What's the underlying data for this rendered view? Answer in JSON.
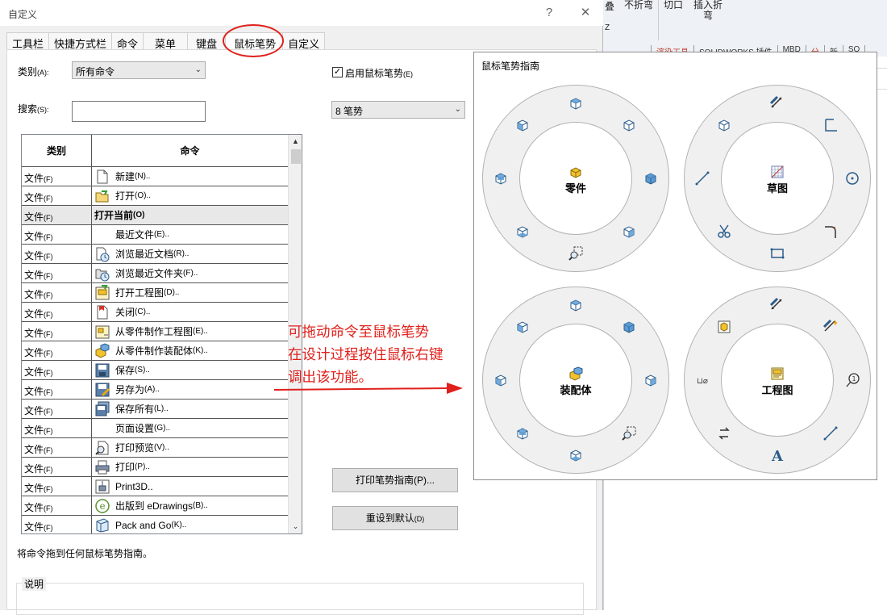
{
  "background_app": {
    "buttons": [
      {
        "label": "不折弯",
        "x": "770",
        "icon": "unfold-icon"
      },
      {
        "label": "切口",
        "icon": "rip-icon"
      },
      {
        "label": "插入折\n弯",
        "icon": "insert-bends-icon"
      }
    ],
    "left_fragments": [
      "叠",
      "Z"
    ],
    "tabs": [
      "",
      "渲染工具",
      "SOLIDWORKS 插件",
      "MBD",
      "分",
      "新",
      "SO"
    ],
    "accent": "#c0392b"
  },
  "dialog": {
    "title": "自定义",
    "help_glyph": "?",
    "close_glyph": "✕",
    "tabs": [
      "工具栏",
      "快捷方式栏",
      "命令",
      "菜单",
      "键盘",
      "鼠标笔势",
      "自定义"
    ],
    "active_tab": "鼠标笔势",
    "category_label": "类别",
    "category_key": "(A):",
    "category_value": "所有命令",
    "search_label": "搜索",
    "search_key": "(S):",
    "search_value": "",
    "enable_label": "启用鼠标笔势",
    "enable_key": "(E)",
    "enable_checked": true,
    "enable_check_glyph": "✓",
    "gesture_count": "8 笔势",
    "table": {
      "headers": [
        "类别",
        "命令"
      ],
      "rows": [
        {
          "cat": "文件",
          "cat_key": "(F)",
          "cmd": "新建",
          "cmd_key": "(N)..",
          "icon": "new-document-icon",
          "group": false
        },
        {
          "cat": "文件",
          "cat_key": "(F)",
          "cmd": "打开",
          "cmd_key": "(O)..",
          "icon": "open-folder-icon",
          "group": false
        },
        {
          "cat": "文件",
          "cat_key": "(F)",
          "cmd": "打开当前",
          "cmd_key": "(O)",
          "icon": "",
          "group": true
        },
        {
          "cat": "文件",
          "cat_key": "(F)",
          "cmd": "最近文件",
          "cmd_key": "(E)..",
          "icon": "",
          "group": false
        },
        {
          "cat": "文件",
          "cat_key": "(F)",
          "cmd": "浏览最近文档",
          "cmd_key": "(R)..",
          "icon": "recent-documents-icon",
          "group": false
        },
        {
          "cat": "文件",
          "cat_key": "(F)",
          "cmd": "浏览最近文件夹",
          "cmd_key": "(F)..",
          "icon": "recent-folders-icon",
          "group": false
        },
        {
          "cat": "文件",
          "cat_key": "(F)",
          "cmd": "打开工程图",
          "cmd_key": "(D)..",
          "icon": "open-drawing-icon",
          "group": false
        },
        {
          "cat": "文件",
          "cat_key": "(F)",
          "cmd": "关闭",
          "cmd_key": "(C)..",
          "icon": "close-document-icon",
          "group": false
        },
        {
          "cat": "文件",
          "cat_key": "(F)",
          "cmd": "从零件制作工程图",
          "cmd_key": "(E)..",
          "icon": "make-drawing-icon",
          "group": false
        },
        {
          "cat": "文件",
          "cat_key": "(F)",
          "cmd": "从零件制作装配体",
          "cmd_key": "(K)..",
          "icon": "make-assembly-icon",
          "group": false
        },
        {
          "cat": "文件",
          "cat_key": "(F)",
          "cmd": "保存",
          "cmd_key": "(S)..",
          "icon": "save-icon",
          "group": false
        },
        {
          "cat": "文件",
          "cat_key": "(F)",
          "cmd": "另存为",
          "cmd_key": "(A)..",
          "icon": "save-as-icon",
          "group": false
        },
        {
          "cat": "文件",
          "cat_key": "(F)",
          "cmd": "保存所有",
          "cmd_key": "(L)..",
          "icon": "save-all-icon",
          "group": false
        },
        {
          "cat": "文件",
          "cat_key": "(F)",
          "cmd": "页面设置",
          "cmd_key": "(G)..",
          "icon": "",
          "group": false
        },
        {
          "cat": "文件",
          "cat_key": "(F)",
          "cmd": "打印预览",
          "cmd_key": "(V)..",
          "icon": "print-preview-icon",
          "group": false
        },
        {
          "cat": "文件",
          "cat_key": "(F)",
          "cmd": "打印",
          "cmd_key": "(P)..",
          "icon": "print-icon",
          "group": false
        },
        {
          "cat": "文件",
          "cat_key": "(F)",
          "cmd": "Print3D..",
          "cmd_key": "",
          "icon": "print3d-icon",
          "group": false
        },
        {
          "cat": "文件",
          "cat_key": "(F)",
          "cmd": "出版到 eDrawings",
          "cmd_key": "(B)..",
          "icon": "edrawings-icon",
          "group": false
        },
        {
          "cat": "文件",
          "cat_key": "(F)",
          "cmd": "Pack and Go",
          "cmd_key": "(K)..",
          "icon": "pack-and-go-icon",
          "group": false
        }
      ]
    },
    "print_button": "打印笔势指南",
    "print_key": "(P)...",
    "reset_button": "重设到默认",
    "reset_key": "(D)",
    "hint": "将命令拖到任何鼠标笔势指南。",
    "description_label": "说明"
  },
  "guide": {
    "title": "鼠标笔势指南",
    "gestures": [
      {
        "label": "零件",
        "center_icon": "part-icon"
      },
      {
        "label": "草图",
        "center_icon": "sketch-icon"
      },
      {
        "label": "装配体",
        "center_icon": "assembly-icon"
      },
      {
        "label": "工程图",
        "center_icon": "drawing-icon"
      }
    ],
    "part_icons": [
      "top-view-icon",
      "isometric-view-icon",
      "shaded-view-icon",
      "right-view-icon",
      "zoom-to-area-icon",
      "bottom-view-icon",
      "back-view-icon",
      "left-view-icon"
    ],
    "sketch_icons": [
      "smart-dimension-icon",
      "corner-rectangle-icon",
      "circle-icon",
      "fillet-icon",
      "rectangle-icon",
      "trim-icon",
      "line-icon",
      "isometric-view-icon"
    ],
    "assembly_icons": [
      "top-view-icon",
      "shaded-view-icon",
      "right-view-icon",
      "zoom-to-area-icon",
      "bottom-view-icon",
      "back-view-icon",
      "left-view-icon",
      "front-view-icon"
    ],
    "drawing_icons": [
      "smart-dimension-icon",
      "auto-dimension-icon",
      "balloon-icon",
      "line-icon",
      "annotation-text-icon",
      "rotate-view-icon",
      "diameter-icon",
      "model-view-icon"
    ],
    "diameter_text": "⊔⌀",
    "balloon_text": "①"
  },
  "annotation": {
    "lines": [
      "可拖动命令至鼠标笔势",
      "在设计过程按住鼠标右键",
      "调出该功能。"
    ],
    "color": "#e0201b"
  }
}
